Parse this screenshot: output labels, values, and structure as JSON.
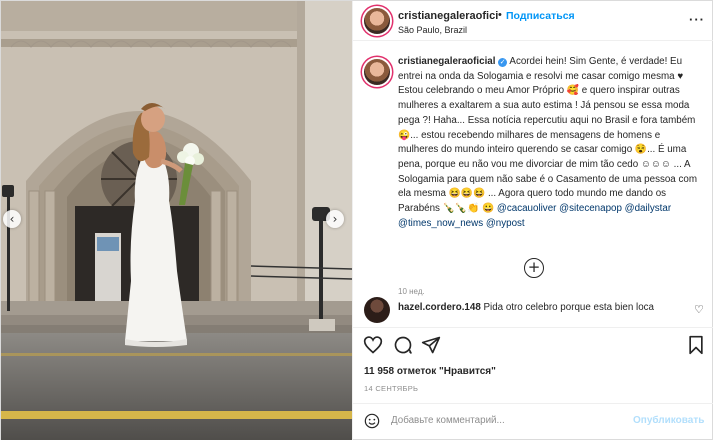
{
  "header": {
    "username": "cristianegaleraofici",
    "separator": "•",
    "follow_label": "Подписаться",
    "location": "São Paulo, Brazil",
    "more_label": "···"
  },
  "caption": {
    "username": "cristianegaleraoficial",
    "verified_glyph": "✓",
    "text_1": "Acordei hein! Sim Gente, é verdade! Eu entrei na onda da Sologamia e resolvi me casar comigo mesma ♥ Estou celebrando o meu Amor Próprio 🥰 e quero inspirar outras mulheres a exaltarem a sua auto estima ! Já pensou se essa moda pega ?! Haha... Essa notícia repercutiu aqui no Brasil e fora também 😜... estou recebendo milhares de mensagens de homens e mulheres do mundo inteiro querendo se casar comigo 😵... É uma pena, porque eu não vou me divorciar de mim tão cedo ☺☺☺ ... A Sologamia para quem não sabe é o Casamento de uma pessoa com ela mesma 😆😆😆 ... Agora quero todo mundo me dando os Parabéns 🍾🍾👏 😀 ",
    "tags": [
      "@cacauoliver",
      "@sitecenapop",
      "@dailystar",
      "@times_now_news",
      "@nypost"
    ],
    "time_ago": "10 нед."
  },
  "load_more_label": "+",
  "comment": {
    "username": "hazel.cordero.148",
    "text": "Pida otro celebro porque esta bien loca",
    "heart": "♡"
  },
  "actions": {
    "likes_text": "11 958 отметок \"Нравится\"",
    "date": "14 СЕНТЯБРЬ"
  },
  "add_comment": {
    "placeholder": "Добавьте комментарий...",
    "publish_label": "Опубликовать"
  },
  "photo": {
    "left_arrow": "‹",
    "right_arrow": "›"
  },
  "colors": {
    "accent": "#0095f6",
    "publish_disabled": "#b2dffc",
    "tag": "#00376b",
    "muted": "#8e8e8e",
    "verified": "#3897f0"
  },
  "icons": [
    "heart-icon",
    "comment-icon",
    "share-icon",
    "bookmark-icon",
    "emoji-icon",
    "plus-circle-icon",
    "verified-icon",
    "more-icon"
  ]
}
